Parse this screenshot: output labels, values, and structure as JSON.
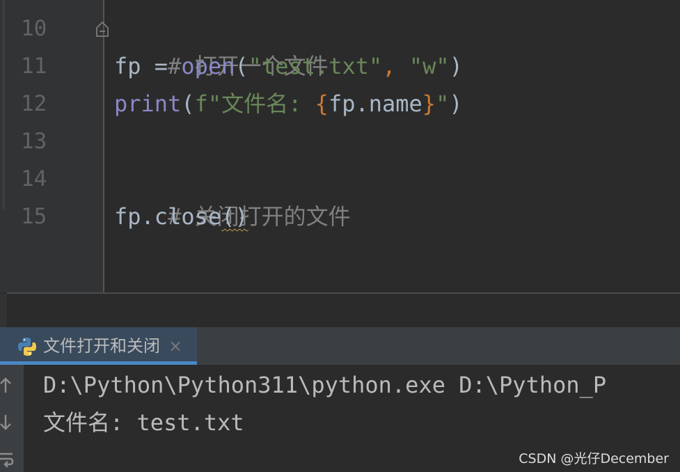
{
  "editor": {
    "line_numbers": [
      "10",
      "11",
      "12",
      "13",
      "14",
      "15"
    ],
    "lines": {
      "l10": {
        "comment": "# 打开一个文件"
      },
      "l11": {
        "var": "fp",
        "assign": " = ",
        "func": "open",
        "open_paren": "(",
        "arg1": "\"test.txt\"",
        "comma": ", ",
        "arg2": "\"w\"",
        "close_paren": ")"
      },
      "l12": {
        "func": "print",
        "open_paren": "(",
        "fstr_start": "f\"文件名: ",
        "brace_open": "{",
        "expr": "fp.name",
        "brace_close": "}",
        "fstr_end": "\"",
        "close_paren": ")"
      },
      "l13": {
        "text": ""
      },
      "l14": {
        "comment": "# 关闭打开的文件"
      },
      "l15": {
        "obj": "fp.close",
        "parens": "()"
      }
    }
  },
  "run_panel": {
    "tab_label": "文件打开和关闭",
    "tab_close": "×",
    "icons": [
      "python-icon",
      "up-arrow-icon",
      "down-arrow-icon",
      "soft-wrap-icon"
    ],
    "console": {
      "line1": "D:\\Python\\Python311\\python.exe D:\\Python_P",
      "line2": "文件名: test.txt"
    }
  },
  "watermark": "CSDN @光仔December",
  "colors": {
    "editor_bg": "#2b2b2b",
    "gutter_bg": "#313335",
    "comment": "#808080",
    "builtin": "#8888c6",
    "string": "#6a8759",
    "brace": "#cc7832",
    "tab_accent": "#4a88c7"
  }
}
